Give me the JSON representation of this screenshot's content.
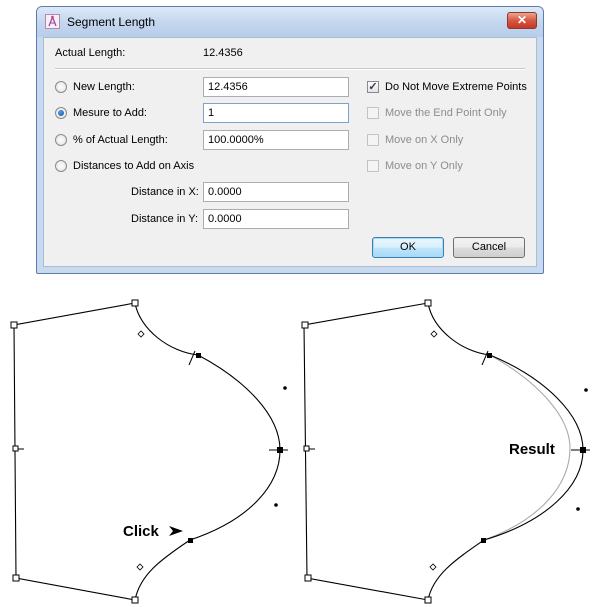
{
  "window": {
    "title": "Segment Length",
    "close_glyph": "✕",
    "app_icon": "compass-pen-icon"
  },
  "actual_length": {
    "label": "Actual Length:",
    "value": "12.4356"
  },
  "options": {
    "new_length": {
      "label": "New Length:",
      "value": "12.4356",
      "selected": false
    },
    "measure_to_add": {
      "label": "Mesure to Add:",
      "value": "1",
      "selected": true
    },
    "percent_of_actual": {
      "label": "% of Actual Length:",
      "value": "100.0000%",
      "selected": false
    },
    "distances_on_axis": {
      "label": "Distances to Add on Axis",
      "selected": false
    },
    "distance_x": {
      "label": "Distance in X:",
      "value": "0.0000"
    },
    "distance_y": {
      "label": "Distance in Y:",
      "value": "0.0000"
    }
  },
  "checkboxes": {
    "do_not_move_extreme": {
      "label": "Do Not Move Extreme Points",
      "checked": true,
      "enabled": true
    },
    "move_end_point_only": {
      "label": "Move the End Point Only",
      "checked": false,
      "enabled": false
    },
    "move_on_x_only": {
      "label": "Move on X Only",
      "checked": false,
      "enabled": false
    },
    "move_on_y_only": {
      "label": "Move on Y Only",
      "checked": false,
      "enabled": false
    }
  },
  "buttons": {
    "ok": "OK",
    "cancel": "Cancel"
  },
  "figures": {
    "left_annotation": "Click",
    "right_annotation": "Result",
    "curve_color_result": "#000000",
    "curve_color_original": "#aaaaaa"
  }
}
